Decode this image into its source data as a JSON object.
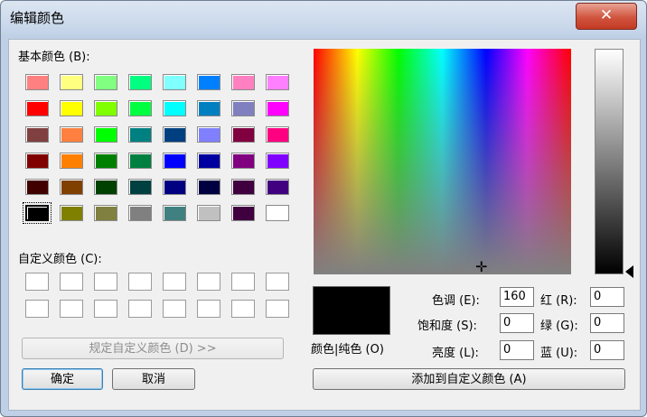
{
  "window": {
    "title": "编辑颜色",
    "close_glyph": "✕"
  },
  "basic": {
    "label": "基本颜色 (B):",
    "rows": [
      [
        "#ff8080",
        "#ffff80",
        "#80ff80",
        "#00ff80",
        "#80ffff",
        "#0080ff",
        "#ff80c0",
        "#ff80ff"
      ],
      [
        "#ff0000",
        "#ffff00",
        "#80ff00",
        "#00ff40",
        "#00ffff",
        "#0080c0",
        "#8080c0",
        "#ff00ff"
      ],
      [
        "#804040",
        "#ff8040",
        "#00ff00",
        "#008080",
        "#004080",
        "#8080ff",
        "#800040",
        "#ff0080"
      ],
      [
        "#800000",
        "#ff8000",
        "#008000",
        "#008040",
        "#0000ff",
        "#0000a0",
        "#800080",
        "#8000ff"
      ],
      [
        "#400000",
        "#804000",
        "#004000",
        "#004040",
        "#000080",
        "#000040",
        "#400040",
        "#400080"
      ],
      [
        "#000000",
        "#808000",
        "#808040",
        "#808080",
        "#408080",
        "#c0c0c0",
        "#400040",
        "#ffffff"
      ]
    ],
    "selected": "#000000"
  },
  "custom": {
    "label": "自定义颜色 (C):",
    "count": 16
  },
  "buttons": {
    "define": "规定自定义颜色 (D) >>",
    "ok": "确定",
    "cancel": "取消",
    "add": "添加到自定义颜色 (A)"
  },
  "preview_label": "颜色|纯色 (O)",
  "fields": {
    "hue": {
      "label": "色调 (E):",
      "value": "160"
    },
    "sat": {
      "label": "饱和度 (S):",
      "value": "0"
    },
    "lum": {
      "label": "亮度 (L):",
      "value": "0"
    },
    "red": {
      "label": "红 (R):",
      "value": "0"
    },
    "green": {
      "label": "绿 (G):",
      "value": "0"
    },
    "blue": {
      "label": "蓝 (U):",
      "value": "0"
    }
  }
}
